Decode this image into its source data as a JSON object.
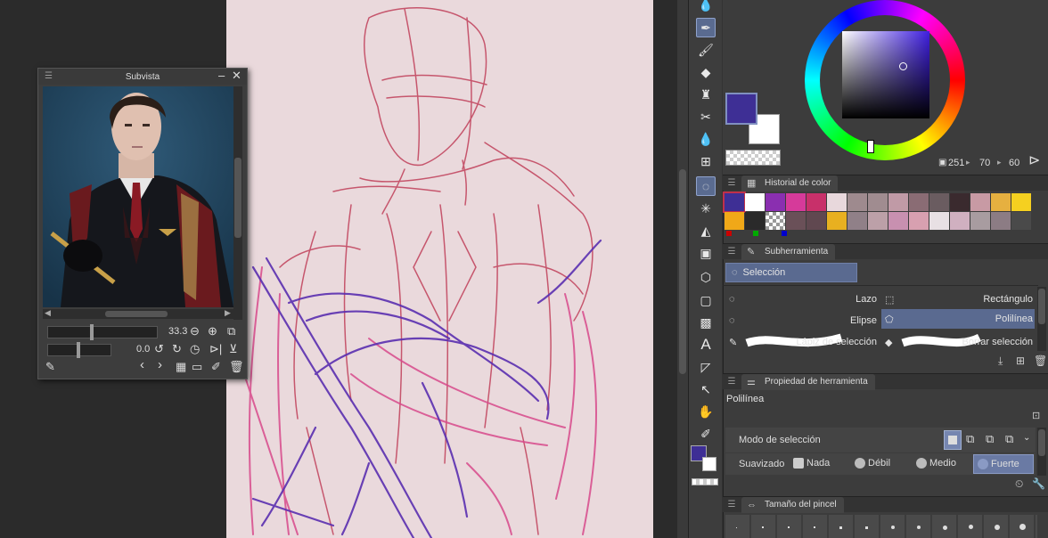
{
  "subview": {
    "title": "Subvista",
    "zoom_value": "33.3",
    "rotation_value": "0.0"
  },
  "color": {
    "fg": "#3e2f95",
    "bg": "#ffffff",
    "hue": "251",
    "saturation": "70",
    "value": "60"
  },
  "color_history": {
    "title": "Historial de color",
    "swatches_row1": [
      "#3e2f95",
      "#ffffff",
      "#8a2fb0",
      "#d63a9a",
      "#c8306a",
      "#e8d8dc",
      "#9e8a8e",
      "#a08c90",
      "#c09aa6",
      "#8a6c74",
      "#6a5c60",
      "#3a2a2e",
      "#c89aa4",
      "#e6b040",
      "#f5d020"
    ],
    "swatches_row2": [
      "#f0a818",
      "#2a2a2a",
      "checker",
      "#6a5058",
      "#604850",
      "#e8b020",
      "#908088",
      "#bca0a8",
      "#c890b0",
      "#d8a0b0",
      "#e8e0e4",
      "#d0b0c0",
      "#a89ca0",
      "#8c7c84",
      "#4a4a4a"
    ]
  },
  "subtool": {
    "title": "Subherramienta",
    "group": "Selección",
    "items": [
      "Lazo",
      "Rectángulo",
      "Elipse",
      "Polilínea",
      "Lápiz de selección",
      "Borrar selección"
    ]
  },
  "tool_property": {
    "title": "Propiedad de herramienta",
    "tool_name": "Polilínea",
    "mode_label": "Modo de selección",
    "smooth_label": "Suavizado",
    "smooth_options": [
      "Nada",
      "Débil",
      "Medio",
      "Fuerte"
    ]
  },
  "brush_size": {
    "title": "Tamaño del pincel"
  },
  "icons": {
    "toolbar": [
      "blend-icon",
      "pen-icon",
      "marker-icon",
      "eraser-icon",
      "fill-stamp-icon",
      "transform-icon",
      "blend2-icon",
      "grid-icon",
      "selection-icon",
      "magic-wand-icon",
      "bucket-icon",
      "gradient-icon",
      "3d-icon",
      "rectangle-icon",
      "pattern-icon",
      "text-icon",
      "ruler-icon",
      "move-icon",
      "hand-icon",
      "eyedropper-icon"
    ]
  }
}
